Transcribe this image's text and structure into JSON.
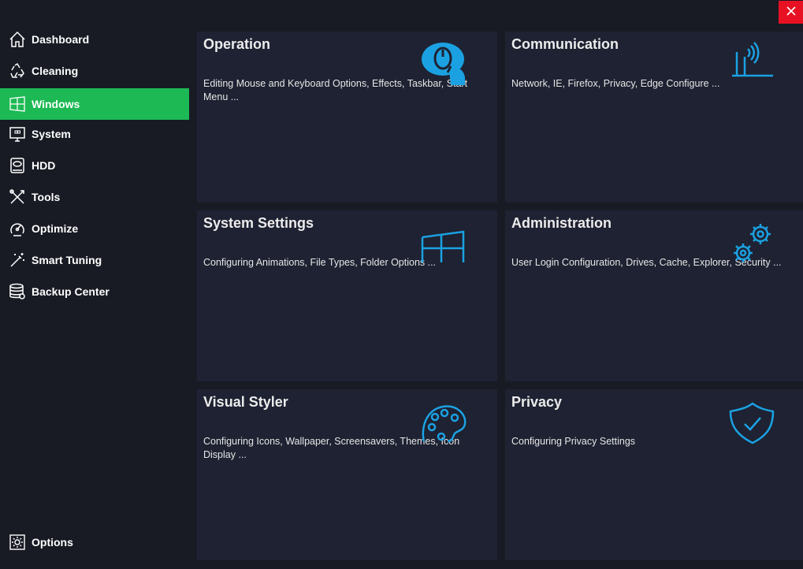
{
  "colors": {
    "accent": "#1db954",
    "icon_blue": "#1ba1e2",
    "close_red": "#e81123",
    "tile_bg": "#1e2232",
    "bg": "#181b24"
  },
  "sidebar": {
    "items": [
      {
        "label": "Dashboard",
        "icon": "home-icon",
        "active": false
      },
      {
        "label": "Cleaning",
        "icon": "recycle-icon",
        "active": false
      },
      {
        "label": "Windows",
        "icon": "windows-icon",
        "active": true
      },
      {
        "label": "System",
        "icon": "monitor-icon",
        "active": false
      },
      {
        "label": "HDD",
        "icon": "hdd-icon",
        "active": false
      },
      {
        "label": "Tools",
        "icon": "tools-icon",
        "active": false
      },
      {
        "label": "Optimize",
        "icon": "speedometer-icon",
        "active": false
      },
      {
        "label": "Smart Tuning",
        "icon": "magic-wand-icon",
        "active": false
      },
      {
        "label": "Backup Center",
        "icon": "database-icon",
        "active": false
      }
    ],
    "options_label": "Options"
  },
  "tiles": [
    {
      "title": "Operation",
      "desc": "Editing Mouse and Keyboard Options, Effects, Taskbar, Start Menu ...",
      "icon": "mouse-icon"
    },
    {
      "title": "Communication",
      "desc": "Network, IE, Firefox, Privacy, Edge Configure ...",
      "icon": "router-icon"
    },
    {
      "title": "System Settings",
      "desc": "Configuring Animations, File Types, Folder Options ...",
      "icon": "windows-logo-icon"
    },
    {
      "title": "Administration",
      "desc": "User Login Configuration, Drives, Cache, Explorer, Security ...",
      "icon": "gears-icon"
    },
    {
      "title": "Visual Styler",
      "desc": "Configuring Icons, Wallpaper, Screensavers, Themes, Icon Display ...",
      "icon": "palette-icon"
    },
    {
      "title": "Privacy",
      "desc": "Configuring Privacy Settings",
      "icon": "shield-check-icon"
    }
  ]
}
